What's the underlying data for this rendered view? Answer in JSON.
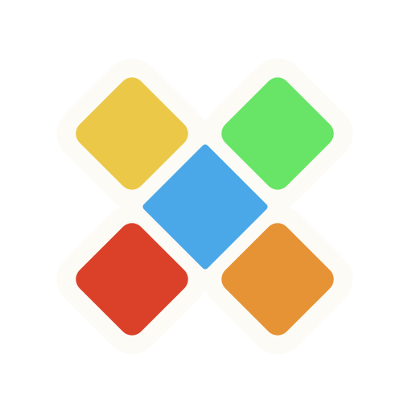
{
  "logo": {
    "shape": "x-cross-of-five-diamonds",
    "outline_color": "#fdfbf6",
    "tiles": [
      {
        "name": "top-left-tile",
        "color": "#ebc847"
      },
      {
        "name": "top-right-tile",
        "color": "#68e567"
      },
      {
        "name": "center-tile",
        "color": "#4aa8e8"
      },
      {
        "name": "bottom-left-tile",
        "color": "#db4129"
      },
      {
        "name": "bottom-right-tile",
        "color": "#e69335"
      }
    ]
  }
}
